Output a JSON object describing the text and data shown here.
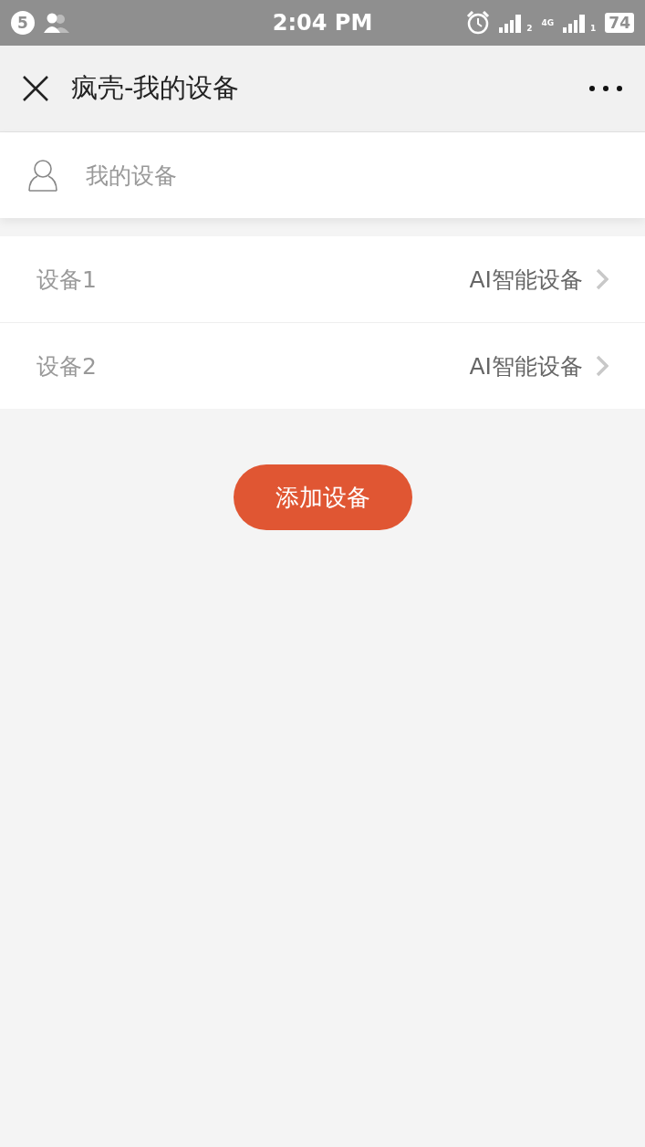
{
  "status_bar": {
    "notification_count": "5",
    "time": "2:04 PM",
    "sim1_label": "2",
    "network": "4G",
    "sim2_label": "1",
    "battery": "74"
  },
  "nav_bar": {
    "title": "疯壳-我的设备"
  },
  "section_header": {
    "label": "我的设备"
  },
  "devices": [
    {
      "name": "设备1",
      "type": "AI智能设备"
    },
    {
      "name": "设备2",
      "type": "AI智能设备"
    }
  ],
  "add_button": {
    "label": "添加设备"
  }
}
